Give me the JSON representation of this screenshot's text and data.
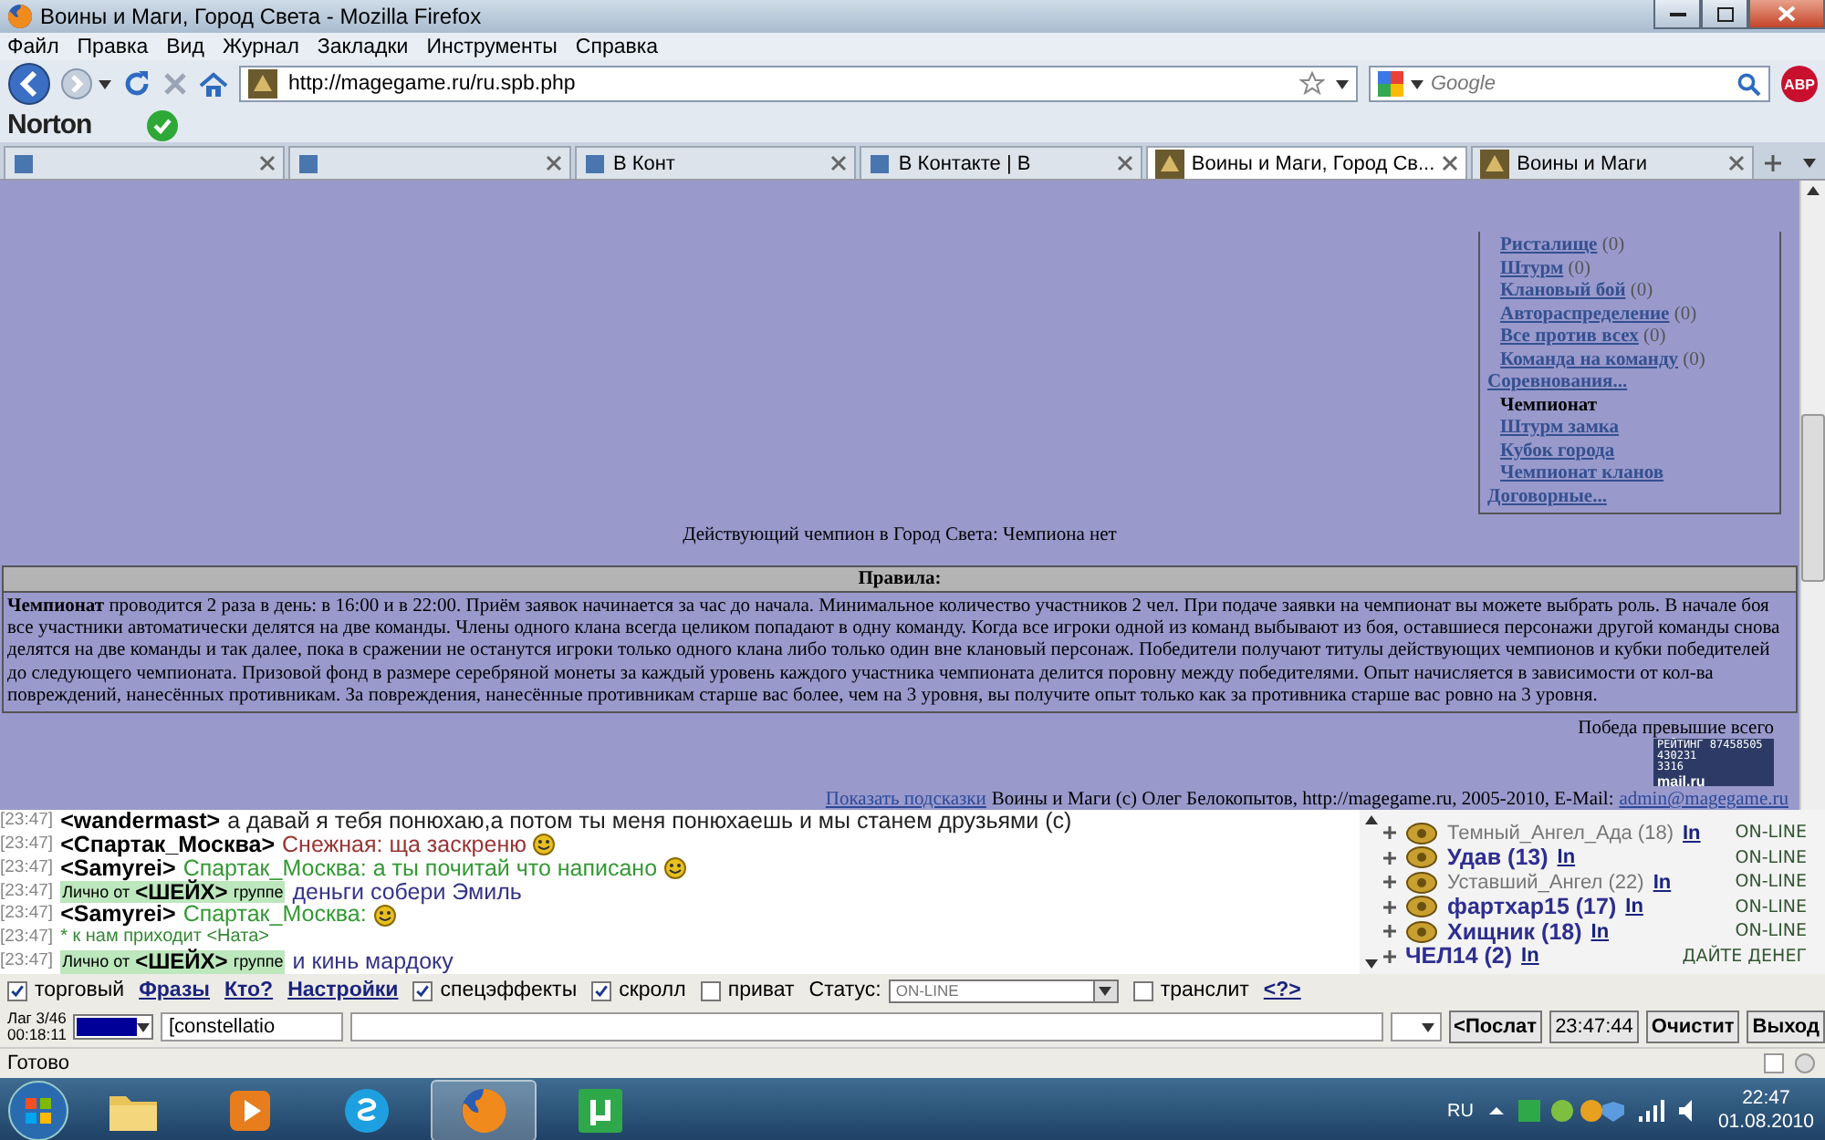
{
  "window": {
    "title": "Воины и Маги, Город Света - Mozilla Firefox"
  },
  "menu_bar": [
    "Файл",
    "Правка",
    "Вид",
    "Журнал",
    "Закладки",
    "Инструменты",
    "Справка"
  ],
  "address_bar": {
    "url": "http://magegame.ru/ru.spb.php"
  },
  "search": {
    "placeholder": "Google"
  },
  "adblock": "ABP",
  "norton": "Norton",
  "tabs": [
    {
      "selected": false
    },
    {
      "selected": false
    },
    {
      "label": "В Конт",
      "selected": false
    },
    {
      "label": "В Контакте | В",
      "selected": false
    },
    {
      "label": "Воины и Маги, Город Св...",
      "selected": true
    },
    {
      "label": "Воины и Маги",
      "selected": false
    }
  ],
  "page": {
    "menu": {
      "group_items": [
        {
          "label": "Ристалище",
          "count": "(0)"
        },
        {
          "label": "Штурм",
          "count": "(0)"
        },
        {
          "label": "Клановый бой",
          "count": "(0)"
        },
        {
          "label": "Автораспределение",
          "count": "(0)"
        },
        {
          "label": "Все против всех",
          "count": "(0)"
        },
        {
          "label": "Команда на команду",
          "count": "(0)"
        }
      ],
      "sections": [
        {
          "label": "Соревнования...",
          "children": [
            {
              "label": "Чемпионат",
              "selected": true
            },
            {
              "label": "Штурм замка",
              "selected": false
            },
            {
              "label": "Кубок города",
              "selected": false
            },
            {
              "label": "Чемпионат кланов",
              "selected": false
            }
          ]
        },
        {
          "label": "Договорные..."
        }
      ]
    },
    "champion": "Действующий чемпион в Город Света: Чемпиона нет",
    "rules": {
      "title": "Правила:",
      "text": "**Чемпионат** проводится 2 раза в день: в 16:00 и в 22:00. Приём заявок начинается за час до начала. Минимальное количество участников 2 чел. При подаче заявки на чемпионат вы можете выбрать роль. В начале боя все участники автоматически делятся на две команды. Члены одного клана всегда целиком попадают в одну команду. Когда все игроки одной из команд выбывают из боя, оставшиеся персонажи другой команды снова делятся на две команды и так далее, пока в сражении не останутся игроки только одного клана либо только один вне клановый персонаж. Победители получают титулы действующих чемпионов и кубки победителей до следующего чемпионата. Призовой фонд в размере серебряной монеты за каждый уровень каждого участника чемпионата делится поровну между победителями. Опыт начисляется в зависимости от кол-ва повреждений, нанесённых противникам. За повреждения, нанесённые противникам старше вас более, чем на 3 уровня, вы получите опыт только как за противника старше вас ровно на 3 уровня."
    },
    "victory_note": "Победа превышие всего",
    "counter": {
      "lines": [
        "РЕЙТИНГ 87458505",
        "430231",
        "3316"
      ],
      "brand": "mail.ru"
    },
    "footer": {
      "hint_link": "Показать подсказки",
      "copyright": "Воины и Маги (с) Олег Белокопытов, http://magegame.ru, 2005-2010, E-Mail:",
      "email": "admin@magegame.ru"
    }
  },
  "chat": [
    {
      "kind": "public",
      "time": "[23:47]",
      "sender": "<wandermast>",
      "text": "а давай я тебя понюхаю,а потом ты меня понюхаешь и мы станем друзьями (с)",
      "color": "#222222",
      "smiley": false
    },
    {
      "kind": "public",
      "time": "[23:47]",
      "sender": "<Спартак_Москва>",
      "text": "Снежная: ща заскреню",
      "color": "#993333",
      "smiley": true
    },
    {
      "kind": "public",
      "time": "[23:47]",
      "sender": "<Samyrei>",
      "text": "Спартак_Москва: а ты почитай что написано",
      "color": "#339933",
      "smiley": true
    },
    {
      "kind": "private",
      "time": "[23:47]",
      "prefix": "Лично от",
      "sender": "<ШЕЙХ>",
      "suffix": "группе",
      "text": "деньги собери Эмиль",
      "color": "#333388",
      "smiley": false
    },
    {
      "kind": "public",
      "time": "[23:47]",
      "sender": "<Samyrei>",
      "text": "Спартак_Москва:",
      "color": "#339933",
      "smiley": true
    },
    {
      "kind": "system",
      "time": "[23:47]",
      "text": "* к нам приходит",
      "sender": "<Ната>",
      "color": "#338833",
      "smiley": false
    },
    {
      "kind": "private",
      "time": "[23:47]",
      "prefix": "Лично от",
      "sender": "<ШЕЙХ>",
      "suffix": "группе",
      "text": "и кинь мардоку",
      "color": "#333388",
      "smiley": false
    }
  ],
  "users": [
    {
      "name": "Темный_Ангел_Ада (18)",
      "link": "In",
      "status": "ON-LINE",
      "bold": false,
      "icon": true
    },
    {
      "name": "Удав (13)",
      "link": "In",
      "status": "ON-LINE",
      "bold": true,
      "icon": true
    },
    {
      "name": "Уставший_Ангел (22)",
      "link": "In",
      "status": "ON-LINE",
      "bold": false,
      "icon": true
    },
    {
      "name": "фартхар15 (17)",
      "link": "In",
      "status": "ON-LINE",
      "bold": true,
      "icon": true
    },
    {
      "name": "Хищник (18)",
      "link": "In",
      "status": "ON-LINE",
      "bold": true,
      "icon": true
    },
    {
      "name": "ЧЕЛ14 (2)",
      "link": "In",
      "status": "ДАЙТЕ ДЕНЕГ",
      "bold": true,
      "icon": false
    }
  ],
  "options": [
    {
      "kind": "checkbox",
      "label": "торговый",
      "checked": true
    },
    {
      "kind": "link",
      "label": "Фразы"
    },
    {
      "kind": "link",
      "label": "Кто?"
    },
    {
      "kind": "link",
      "label": "Настройки"
    },
    {
      "kind": "checkbox",
      "label": "спецэффекты",
      "checked": true
    },
    {
      "kind": "checkbox",
      "label": "скролл",
      "checked": true
    },
    {
      "kind": "checkbox",
      "label": "приват",
      "checked": false
    },
    {
      "kind": "select",
      "label": "Статус:",
      "value": "ON-LINE"
    },
    {
      "kind": "checkbox",
      "label": "транслит",
      "checked": false
    },
    {
      "kind": "link",
      "label": "<?>"
    }
  ],
  "input_bar": {
    "lag": "Лаг 3/46",
    "timer": "00:18:11",
    "color": "#000099",
    "nick_value": "[constellatio",
    "buttons": [
      "<Послат",
      "23:47:44",
      "Очистит",
      "Выход"
    ]
  },
  "status_bar": "Готово",
  "taskbar": {
    "apps": [
      {
        "kind": "folder",
        "selected": false
      },
      {
        "kind": "media",
        "selected": false
      },
      {
        "kind": "skype",
        "selected": false
      },
      {
        "kind": "browser",
        "selected": true
      },
      {
        "kind": "torrent",
        "selected": false
      }
    ],
    "language": "RU",
    "time": "22:47",
    "date": "01.08.2010"
  }
}
